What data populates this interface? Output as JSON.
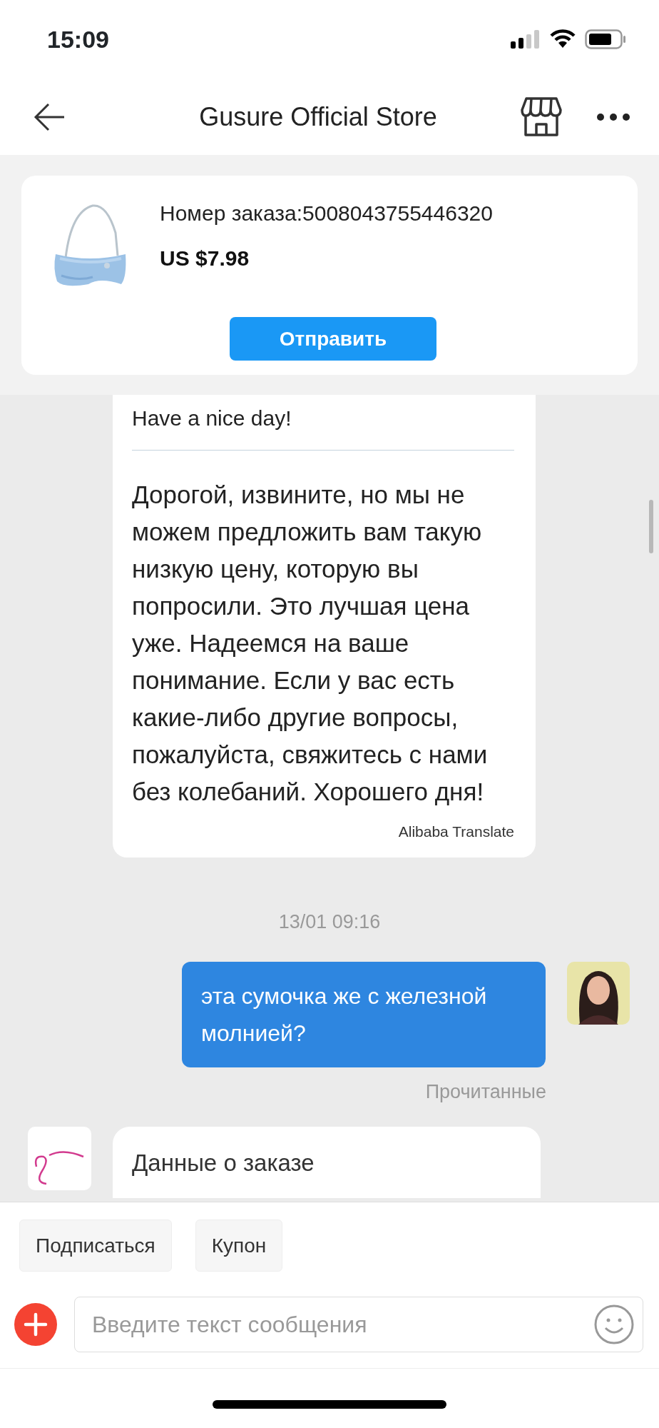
{
  "status_bar": {
    "time": "15:09"
  },
  "header": {
    "title": "Gusure Official Store"
  },
  "order_card": {
    "order_number": "Номер заказа:5008043755446320",
    "price": "US $7.98",
    "button": "Отправить"
  },
  "messages": [
    {
      "kind": "translated",
      "outgoing": false,
      "original": "Have a nice day!",
      "translation": "Дорогой, извините, но мы не можем предложить вам такую низкую цену, которую вы попросили. Это лучшая цена уже. Надеемся на ваше понимание. Если у вас есть какие-либо другие вопросы, пожалуйста, свяжитесь с нами без колебаний. Хорошего дня!",
      "credit": "Alibaba Translate"
    },
    {
      "kind": "timestamp",
      "text": "13/01 09:16"
    },
    {
      "kind": "text",
      "outgoing": true,
      "text": "эта сумочка же с железной молнией?",
      "status": "Прочитанные"
    },
    {
      "kind": "card",
      "outgoing": false,
      "title": "Данные о заказе"
    }
  ],
  "quick_replies": [
    "Подписаться",
    "Купон"
  ],
  "composer": {
    "placeholder": "Введите текст сообщения"
  }
}
